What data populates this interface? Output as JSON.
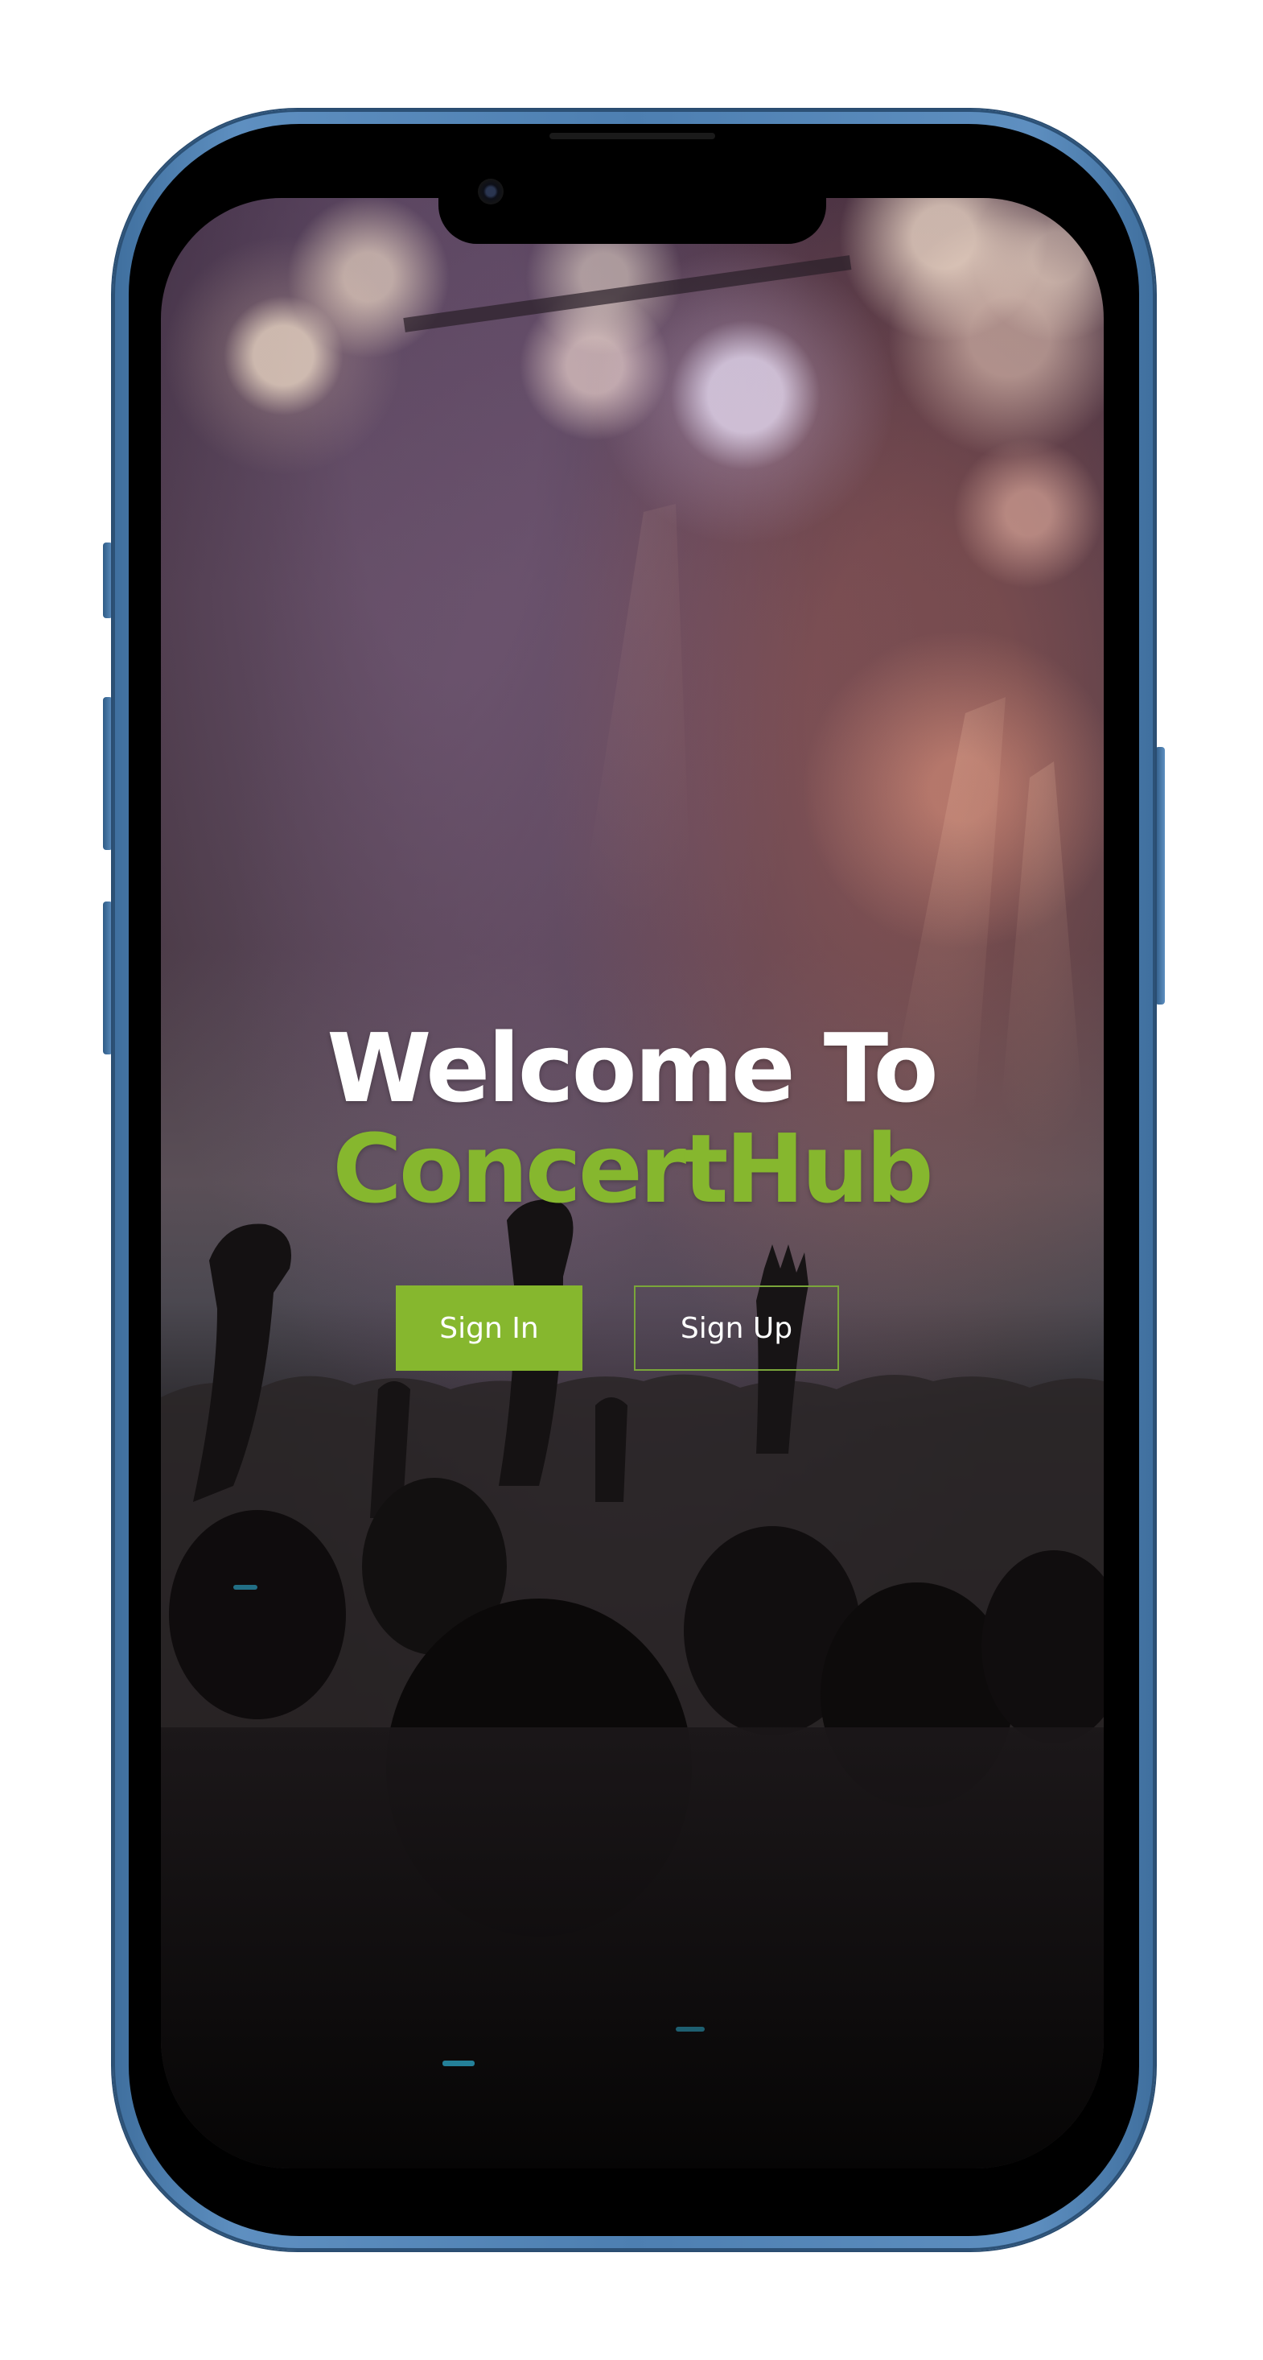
{
  "welcome": {
    "line1": "Welcome To",
    "line2": "ConcertHub"
  },
  "actions": {
    "sign_in_label": "Sign In",
    "sign_up_label": "Sign Up"
  },
  "colors": {
    "accent": "#86b72e",
    "text": "#ffffff",
    "phone_frame": "#4d7fb1"
  }
}
